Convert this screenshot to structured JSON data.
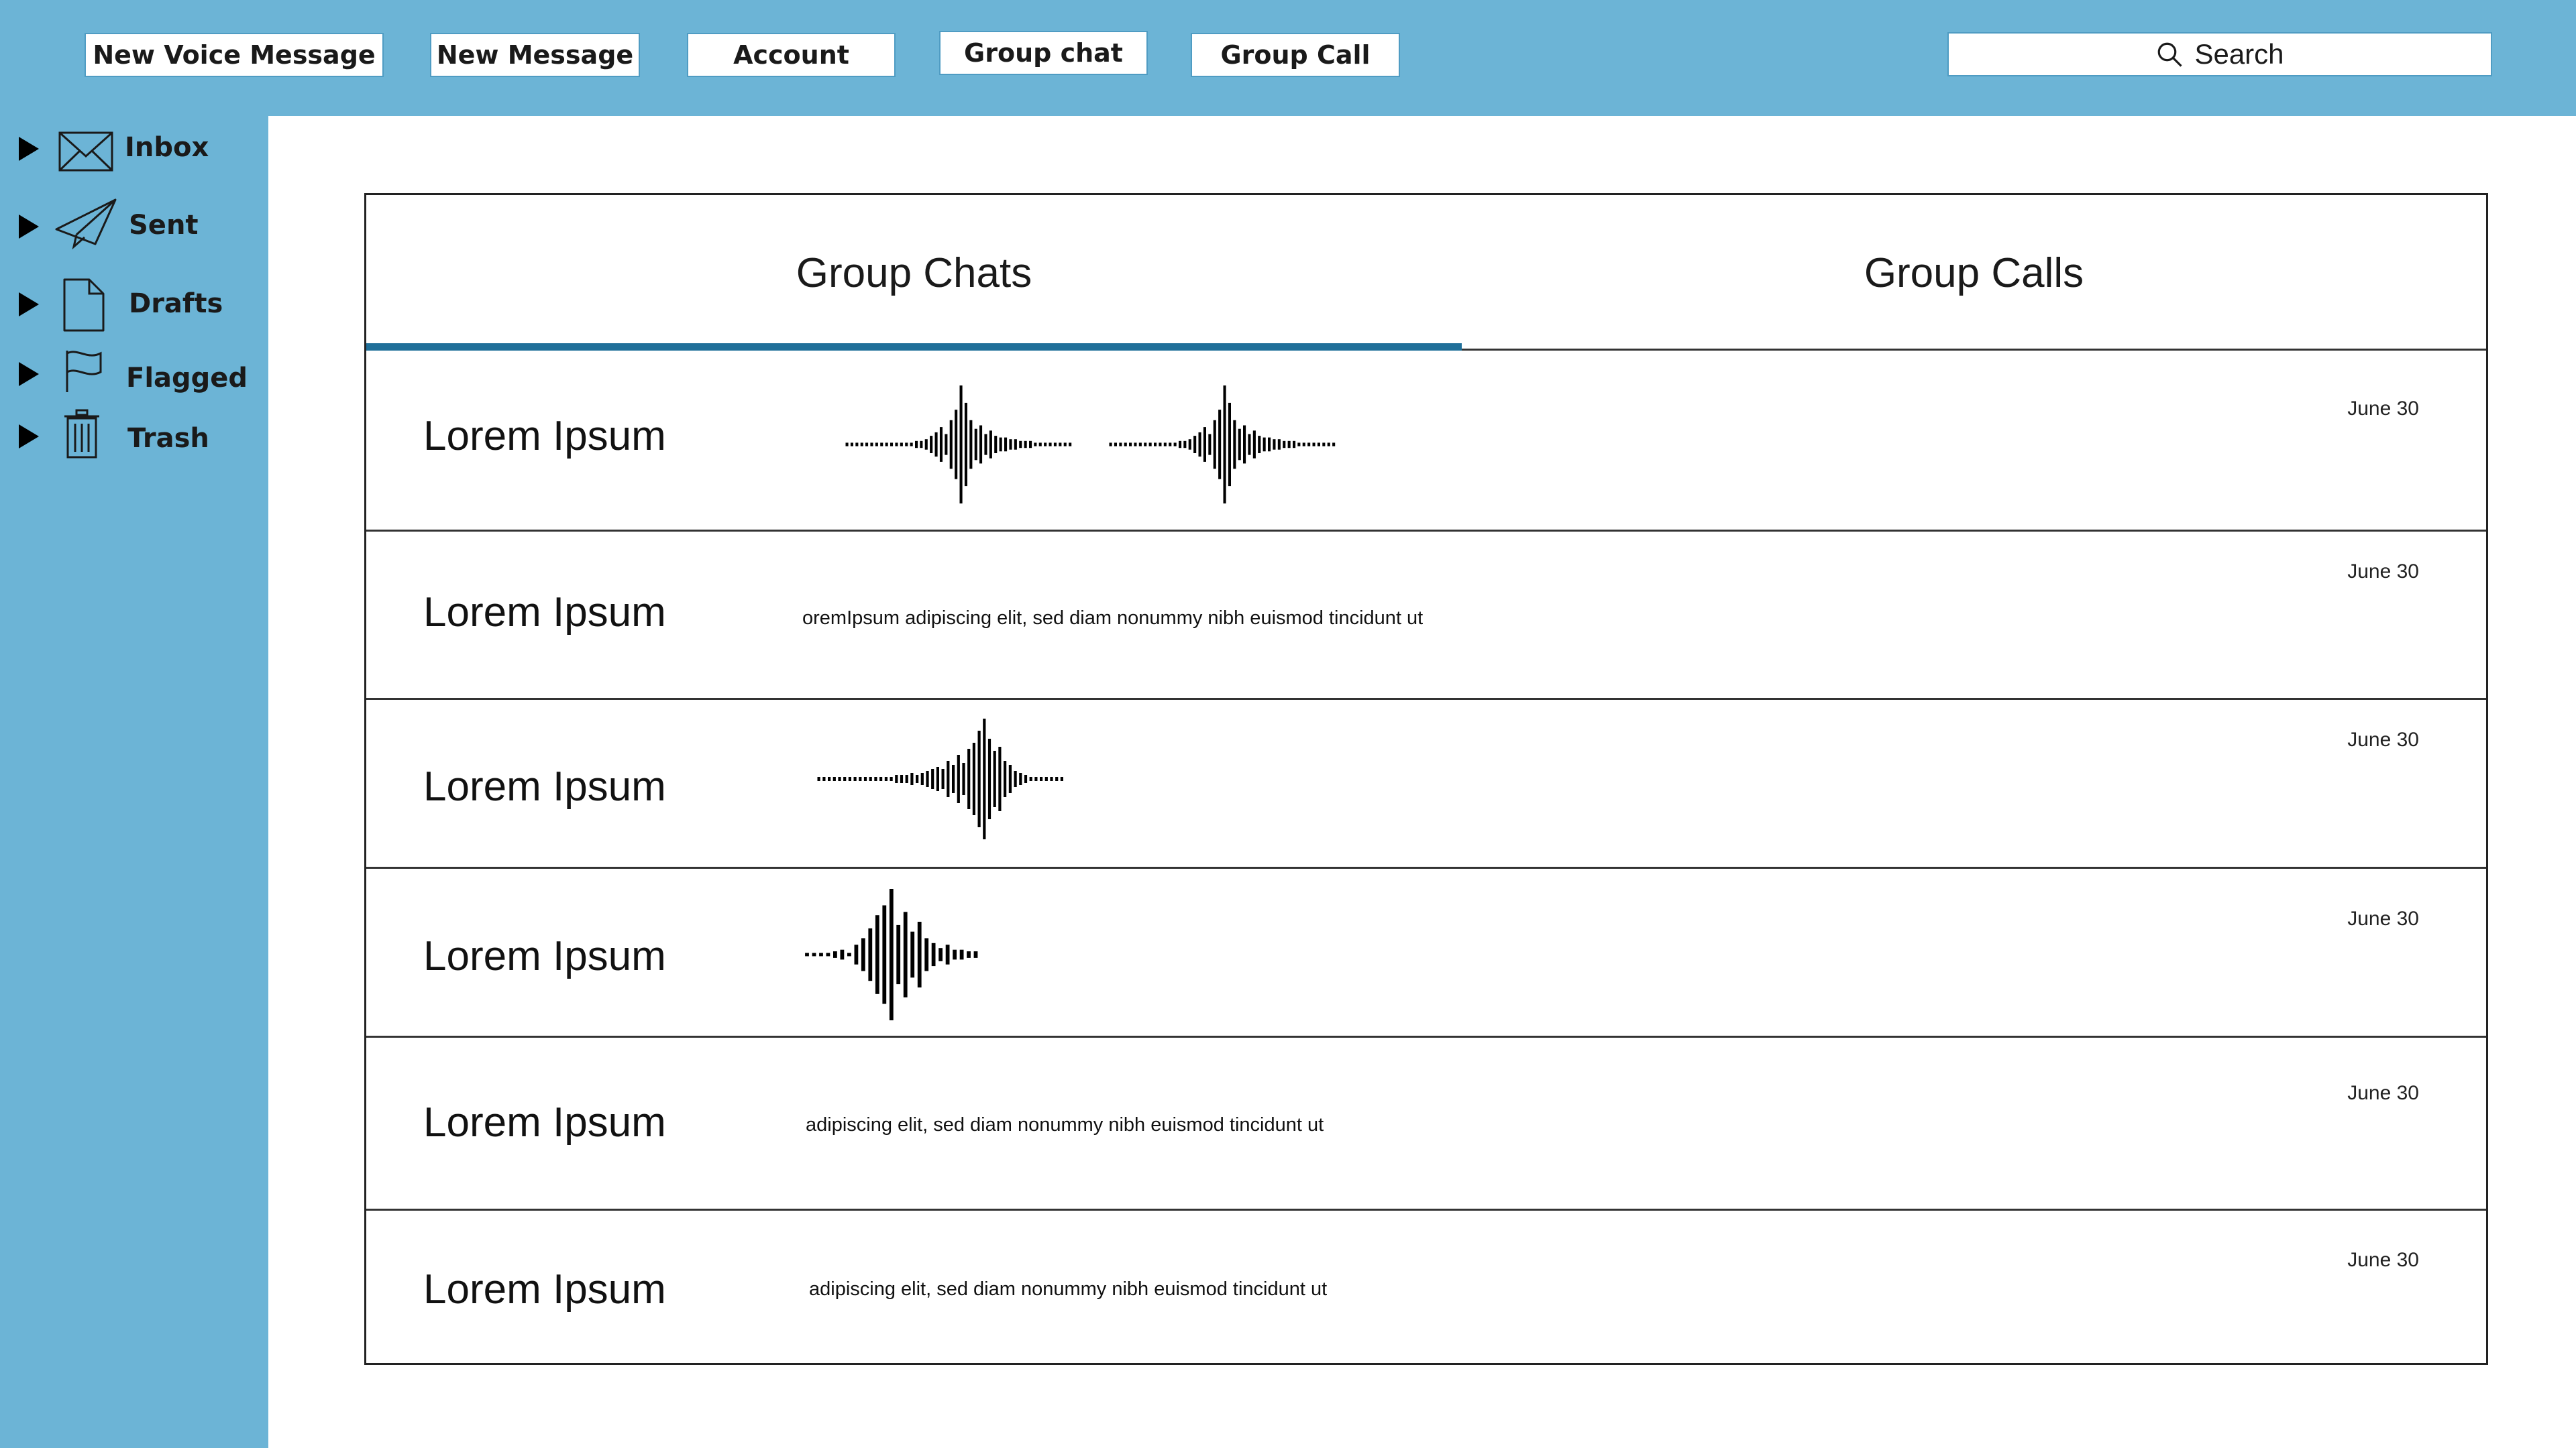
{
  "toolbar": {
    "buttons": [
      "New  Voice Message",
      "New Message",
      "Account",
      "Group chat",
      "Group Call"
    ],
    "search_label": "Search"
  },
  "sidebar": {
    "items": [
      {
        "label": "Inbox",
        "icon": "envelope-icon"
      },
      {
        "label": "Sent",
        "icon": "paper-plane-icon"
      },
      {
        "label": "Drafts",
        "icon": "document-icon"
      },
      {
        "label": "Flagged",
        "icon": "flag-icon"
      },
      {
        "label": "Trash",
        "icon": "trash-icon"
      }
    ]
  },
  "tabs": [
    {
      "label": "Group Chats",
      "active": true
    },
    {
      "label": "Group Calls",
      "active": false
    }
  ],
  "conversations": [
    {
      "name": "Lorem Ipsum",
      "date": "June 30",
      "type": "voice",
      "voice_messages": 2
    },
    {
      "name": "Lorem Ipsum",
      "date": "June 30",
      "type": "text",
      "preview": "oremIpsum  adipiscing elit, sed diam nonummy nibh euismod tincidunt ut"
    },
    {
      "name": "Lorem Ipsum",
      "date": "June 30",
      "type": "voice",
      "voice_messages": 1
    },
    {
      "name": "Lorem Ipsum",
      "date": "June 30",
      "type": "voice",
      "voice_messages": 1
    },
    {
      "name": "Lorem Ipsum",
      "date": "June 30",
      "type": "text",
      "preview": "adipiscing elit, sed diam nonummy nibh euismod tincidunt ut"
    },
    {
      "name": "Lorem Ipsum",
      "date": "June 30",
      "type": "text",
      "preview": "adipiscing elit, sed diam nonummy nibh euismod tincidunt ut"
    }
  ],
  "colors": {
    "background": "#6cb4d6",
    "content": "#ffffff",
    "active_tab": "#1f6f99"
  }
}
